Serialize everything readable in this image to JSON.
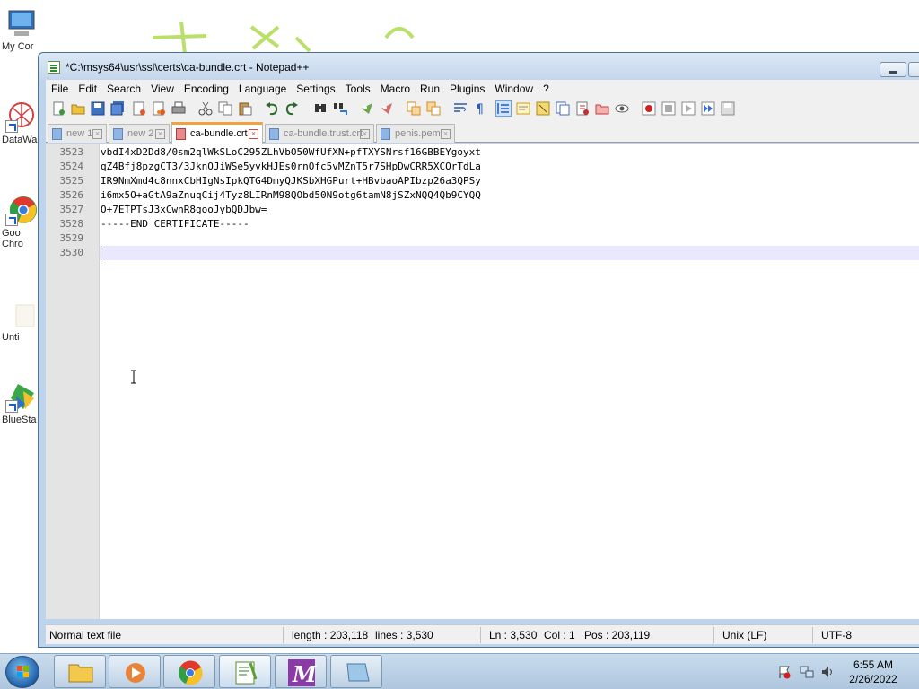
{
  "window": {
    "title": "*C:\\msys64\\usr\\ssl\\certs\\ca-bundle.crt - Notepad++"
  },
  "desktop_icons": [
    {
      "label": "My Cor"
    },
    {
      "label": "DataWa"
    },
    {
      "label": "Goo"
    },
    {
      "label": "Chro"
    },
    {
      "label": "Unti"
    },
    {
      "label": "BlueSta"
    }
  ],
  "menu": [
    "File",
    "Edit",
    "Search",
    "View",
    "Encoding",
    "Language",
    "Settings",
    "Tools",
    "Macro",
    "Run",
    "Plugins",
    "Window",
    "?"
  ],
  "toolbar_icons": [
    "new-file",
    "open-file",
    "save",
    "save-all",
    "close",
    "close-all",
    "print",
    "cut",
    "copy",
    "paste",
    "undo",
    "redo",
    "find",
    "replace",
    "zoom-in",
    "zoom-out",
    "sync-vertical",
    "sync-horizontal",
    "word-wrap",
    "show-all-chars",
    "indent-guide",
    "user-defined-language",
    "document-map",
    "function-list",
    "folder-as-workspace",
    "monitoring",
    "record-macro",
    "stop-recording",
    "playback-macro",
    "run-macro-multiple",
    "save-macro"
  ],
  "tabs": [
    {
      "label": "new 1",
      "active": false,
      "dirty": false
    },
    {
      "label": "new 2",
      "active": false,
      "dirty": false
    },
    {
      "label": "ca-bundle.crt",
      "active": true,
      "dirty": true
    },
    {
      "label": "ca-bundle.trust.crt",
      "active": false,
      "dirty": false
    },
    {
      "label": "penis.pem",
      "active": false,
      "dirty": false
    }
  ],
  "editor": {
    "lines": [
      {
        "num": "3523",
        "text": "vbdI4xD2Dd8/0sm2qlWkSLoC295ZLhVbO50WfUfXN+pfTXYSNrsf16GBBEYgoyxt"
      },
      {
        "num": "3524",
        "text": "qZ4Bfj8pzgCT3/3JknOJiWSe5yvkHJEs0rnOfc5vMZnT5r7SHpDwCRR5XCOrTdLa"
      },
      {
        "num": "3525",
        "text": "IR9NmXmd4c8nnxCbHIgNsIpkQTG4DmyQJKSbXHGPurt+HBvbaoAPIbzp26a3QPSy"
      },
      {
        "num": "3526",
        "text": "i6mx5O+aGtA9aZnuqCij4Tyz8LIRnM98QObd50N9otg6tamN8jSZxNQQ4Qb9CYQQ"
      },
      {
        "num": "3527",
        "text": "O+7ETPTsJ3xCwnR8gooJybQDJbw="
      },
      {
        "num": "3528",
        "text": "-----END CERTIFICATE-----"
      },
      {
        "num": "3529",
        "text": ""
      },
      {
        "num": "3530",
        "text": ""
      }
    ],
    "current_line_index": 7
  },
  "status": {
    "file_type": "Normal text file",
    "length": "length : 203,118",
    "lines": "lines : 3,530",
    "ln": "Ln : 3,530",
    "col": "Col : 1",
    "pos": "Pos : 203,119",
    "eol": "Unix (LF)",
    "encoding": "UTF-8"
  },
  "taskbar": {
    "apps": [
      "explorer",
      "media-player",
      "chrome",
      "notepad-plus-plus",
      "visual-studio",
      "unknown-app"
    ],
    "time": "6:55 AM",
    "date": "2/26/2022"
  },
  "colors": {
    "active_tab_accent": "#f2a23d",
    "current_line_bg": "#e8e8ff",
    "gutter_bg": "#e4e4e4"
  }
}
